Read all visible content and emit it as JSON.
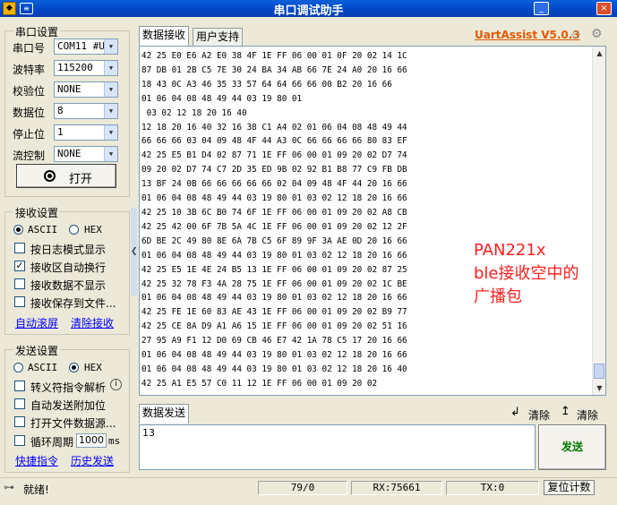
{
  "window": {
    "title": "串口调试助手",
    "sysmenu": "≡",
    "minimize": "_",
    "close": "×"
  },
  "serial": {
    "group_title": "串口设置",
    "port_label": "串口号",
    "port_value": "COM11 #U",
    "baud_label": "波特率",
    "baud_value": "115200",
    "parity_label": "校验位",
    "parity_value": "NONE",
    "data_label": "数据位",
    "data_value": "8",
    "stop_label": "停止位",
    "stop_value": "1",
    "flow_label": "流控制",
    "flow_value": "NONE",
    "open_label": "打开"
  },
  "recv_settings": {
    "group_title": "接收设置",
    "ascii": "ASCII",
    "hex": "HEX",
    "selected": "ASCII",
    "opt_log": "按日志模式显示",
    "opt_autowrap": "接收区自动换行",
    "opt_hide": "接收数据不显示",
    "opt_save": "接收保存到文件...",
    "autowrap_checked": true,
    "link_autoscroll": "自动滚屏",
    "link_clear": "清除接收"
  },
  "send_settings": {
    "group_title": "发送设置",
    "ascii": "ASCII",
    "hex": "HEX",
    "selected": "HEX",
    "opt_escape": "转义符指令解析",
    "opt_append": "自动发送附加位",
    "opt_file": "打开文件数据源...",
    "opt_cycle": "循环周期",
    "cycle_value": "1000",
    "cycle_unit": "ms",
    "link_shortcut": "快捷指令",
    "link_history": "历史发送"
  },
  "tabs": {
    "recv": "数据接收",
    "plugin": "用户支持"
  },
  "brand": "UartAssist V5.0.3",
  "recv_text": "42 25 E0 E6 A2 E0 38 4F 1E FF 06 00 01 0F 20 02 14 1C\n87 DB 01 2B C5 7E 30 24 BA 34 AB 66 7E 24 A0 20 16 66\n18 43 0C A3 46 35 33 57 64 64 66 66 00 B2 20 16 66\n01 06 04 08 48 49 44 03 19 80 01\n 03 02 12 18 20 16 40\n12 18 20 16 40 32 16 38 C1 A4 02 01 06 04 08 48 49 44\n66 66 66 03 04 09 48 4F 44 A3 0C 66 66 66 66 80 83 EF\n42 25 E5 B1 D4 02 87 71 1E FF 06 00 01 09 20 02 D7 74\n09 20 02 D7 74 C7 2D 35 ED 9B 02 92 B1 B8 77 C9 FB DB\n13 BF 24 0B 66 66 66 66 66 02 04 09 48 4F 44 20 16 66\n01 06 04 08 48 49 44 03 19 80 01 03 02 12 18 20 16 66\n42 25 10 3B 6C B0 74 6F 1E FF 06 00 01 09 20 02 A8 CB\n42 25 42 00 6F 7B 5A 4C 1E FF 06 00 01 09 20 02 12 2F\n6D BE 2C 49 80 8E 6A 7B C5 6F 89 9F 3A AE 0D 20 16 66\n01 06 04 08 48 49 44 03 19 80 01 03 02 12 18 20 16 66\n42 25 E5 1E 4E 24 B5 13 1E FF 06 00 01 09 20 02 87 25\n42 25 32 78 F3 4A 28 75 1E FF 06 00 01 09 20 02 1C BE\n01 06 04 08 48 49 44 03 19 80 01 03 02 12 18 20 16 66\n42 25 FE 1E 60 83 AE 43 1E FF 06 00 01 09 20 02 B9 77\n42 25 CE 8A D9 A1 A6 15 1E FF 06 00 01 09 20 02 51 16\n27 95 A9 F1 12 D0 69 CB 46 E7 42 1A 78 C5 17 20 16 66\n01 06 04 08 48 49 44 03 19 80 01 03 02 12 18 20 16 66\n01 06 04 08 48 49 44 03 19 80 01 03 02 12 18 20 16 40\n42 25 A1 E5 57 C0 11 12 1E FF 06 00 01 09 20 02",
  "annotation": "PAN221x\nble接收空中的\n广播包",
  "send": {
    "tab": "数据发送",
    "clear1": "清除",
    "clear2": "清除",
    "input": "13",
    "send_button": "发送"
  },
  "status": {
    "ready": "就绪!",
    "count": "79/0",
    "rx": "RX:75661",
    "tx": "TX:0",
    "reset": "复位计数"
  }
}
